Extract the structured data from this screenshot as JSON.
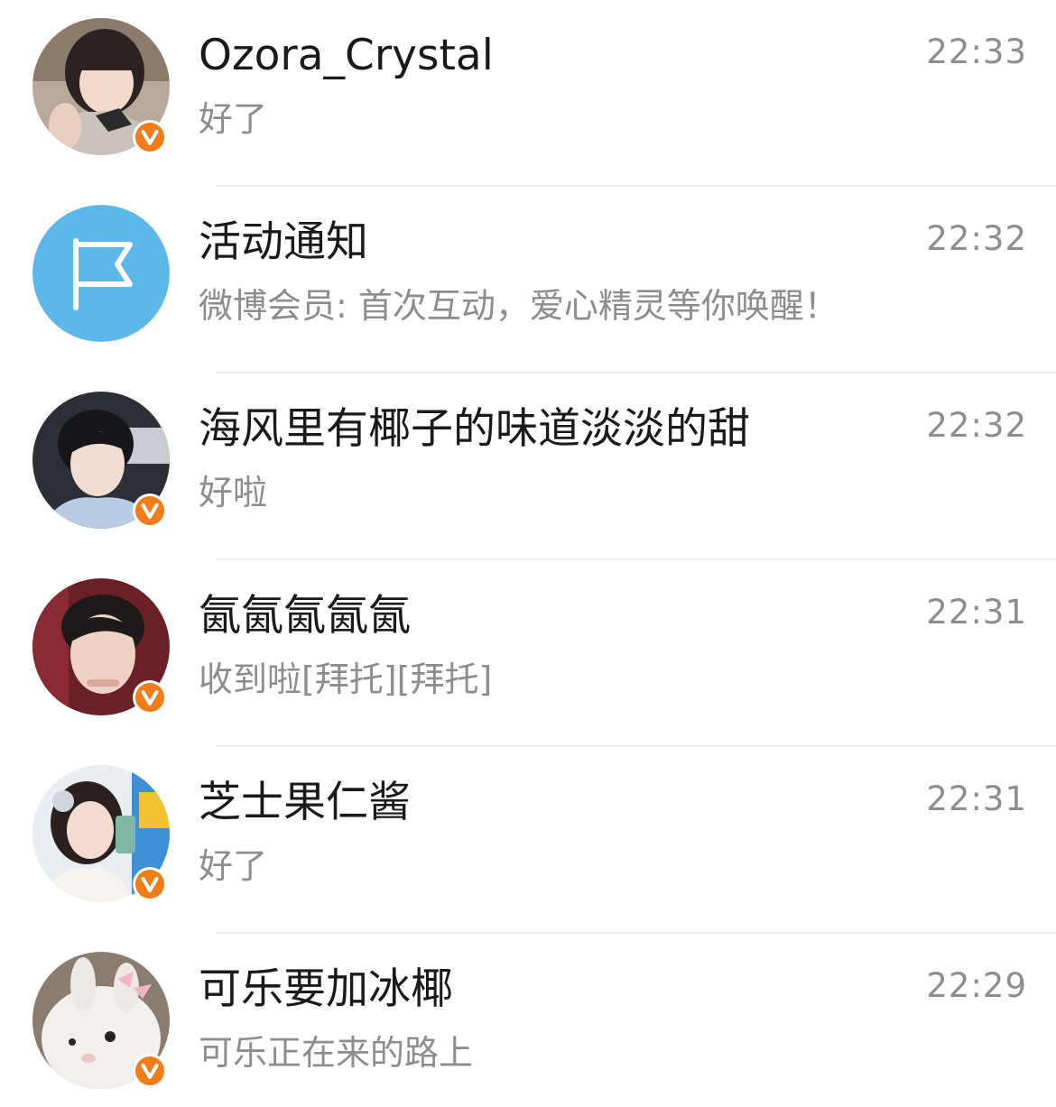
{
  "colors": {
    "verified_badge": "#f07c1a",
    "notice_avatar": "#5db8ea",
    "name_text": "#1a1a1a",
    "secondary_text": "#8d8d8d",
    "divider": "#ececec"
  },
  "conversations": [
    {
      "name": "Ozora_Crystal",
      "preview": "好了",
      "time": "22:33",
      "verified": true,
      "avatar": "photo-girl-short-hair"
    },
    {
      "name": "活动通知",
      "preview": "微博会员: 首次互动，爱心精灵等你唤醒！",
      "time": "22:32",
      "verified": false,
      "avatar": "flag-icon"
    },
    {
      "name": "海风里有椰子的味道淡淡的甜",
      "preview": "好啦",
      "time": "22:32",
      "verified": true,
      "avatar": "photo-boy-dark-hair"
    },
    {
      "name": "氤氤氤氤氤",
      "preview": "收到啦[拜托][拜托]",
      "time": "22:31",
      "verified": true,
      "avatar": "photo-boy-red-bg"
    },
    {
      "name": "芝士果仁酱",
      "preview": "好了",
      "time": "22:31",
      "verified": true,
      "avatar": "photo-girl-selfie"
    },
    {
      "name": "可乐要加冰椰",
      "preview": "可乐正在来的路上",
      "time": "22:29",
      "verified": true,
      "avatar": "photo-white-bunny"
    }
  ]
}
